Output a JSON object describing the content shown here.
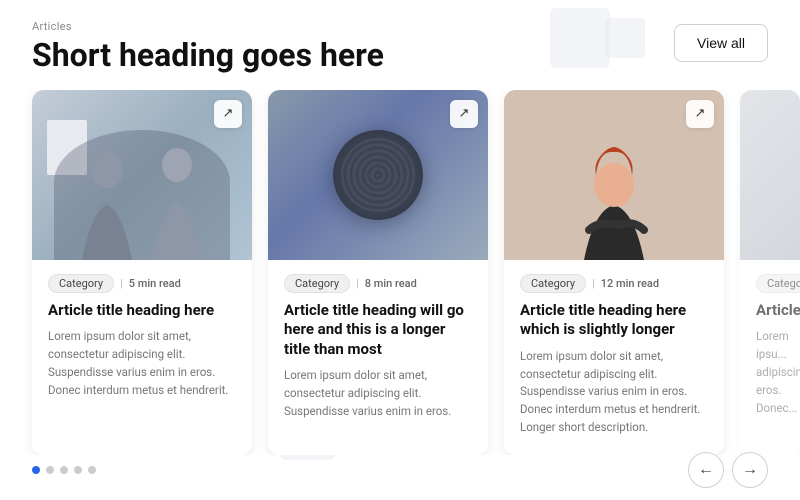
{
  "header": {
    "section_label": "Articles",
    "heading": "Short heading goes here",
    "view_all": "View all"
  },
  "cards": [
    {
      "id": 1,
      "category": "Category",
      "read_time": "5 min read",
      "title": "Article title heading here",
      "description": "Lorem ipsum dolor sit amet, consectetur adipiscing elit. Suspendisse varius enim in eros. Donec interdum metus et hendrerit.",
      "img_type": "people"
    },
    {
      "id": 2,
      "category": "Category",
      "read_time": "8 min read",
      "title": "Article title heading will go here and this is a longer title than most",
      "description": "Lorem ipsum dolor sit amet, consectetur adipiscing elit. Suspendisse varius enim in eros.",
      "img_type": "device"
    },
    {
      "id": 3,
      "category": "Category",
      "read_time": "12 min read",
      "title": "Article title heading here which is slightly longer",
      "description": "Lorem ipsum dolor sit amet, consectetur adipiscing elit. Suspendisse varius enim in eros. Donec interdum metus et hendrerit. Longer short description.",
      "img_type": "person"
    },
    {
      "id": 4,
      "category": "Category",
      "read_time": "",
      "title": "Article",
      "description": "Lorem ipsu... adipiscing... eros. Donec...",
      "img_type": "light",
      "partial": true
    }
  ],
  "pagination": {
    "dots": [
      {
        "active": true
      },
      {
        "active": false
      },
      {
        "active": false
      },
      {
        "active": false
      },
      {
        "active": false
      }
    ],
    "prev_label": "←",
    "next_label": "→"
  }
}
